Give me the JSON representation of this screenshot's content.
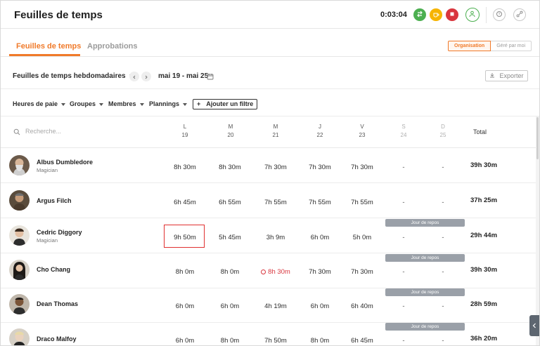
{
  "header": {
    "title": "Feuilles de temps",
    "timer": "0:03:04",
    "colors": {
      "accent": "#f07a2a",
      "green": "#4caf50",
      "yellow": "#f6b400",
      "red": "#d9363e"
    }
  },
  "tabs": [
    {
      "label": "Feuilles de temps",
      "active": true
    },
    {
      "label": "Approbations",
      "active": false
    }
  ],
  "view_toggle": {
    "left": "Organisation",
    "right": "Géré par moi",
    "selected": "Organisation"
  },
  "week": {
    "selector_label": "Feuilles de temps hebdomadaires",
    "range": "mai 19 - mai 25",
    "export_label": "Exporter"
  },
  "filters": {
    "items": [
      "Heures de paie",
      "Groupes",
      "Membres",
      "Plannings"
    ],
    "add_label": "Ajouter un filtre"
  },
  "table": {
    "search_placeholder": "Recherche...",
    "days": [
      {
        "letter": "L",
        "date": "19"
      },
      {
        "letter": "M",
        "date": "20"
      },
      {
        "letter": "M",
        "date": "21"
      },
      {
        "letter": "J",
        "date": "22"
      },
      {
        "letter": "V",
        "date": "23"
      },
      {
        "letter": "S",
        "date": "24"
      },
      {
        "letter": "D",
        "date": "25"
      }
    ],
    "total_label": "Total",
    "repos_label": "Jour de repos",
    "rows": [
      {
        "name": "Albus Dumbledore",
        "role": "Magician",
        "cells": [
          "8h 30m",
          "8h 30m",
          "7h 30m",
          "7h 30m",
          "7h 30m",
          "-",
          "-"
        ],
        "total": "39h 30m"
      },
      {
        "name": "Argus Filch",
        "role": "",
        "cells": [
          "6h 45m",
          "6h 55m",
          "7h 55m",
          "7h 55m",
          "7h 55m",
          "-",
          "-"
        ],
        "total": "37h 25m"
      },
      {
        "name": "Cedric Diggory",
        "role": "Magician",
        "cells": [
          "9h 50m",
          "5h 45m",
          "3h 9m",
          "6h 0m",
          "5h 0m",
          "-",
          "-"
        ],
        "total": "29h 44m"
      },
      {
        "name": "Cho Chang",
        "role": "",
        "cells": [
          "8h 0m",
          "8h 0m",
          "8h 30m",
          "7h 30m",
          "7h 30m",
          "-",
          "-"
        ],
        "total": "39h 30m"
      },
      {
        "name": "Dean Thomas",
        "role": "",
        "cells": [
          "6h 0m",
          "6h 0m",
          "4h 19m",
          "6h 0m",
          "6h 40m",
          "-",
          "-"
        ],
        "total": "28h 59m"
      },
      {
        "name": "Draco Malfoy",
        "role": "",
        "cells": [
          "6h 0m",
          "8h 0m",
          "7h 50m",
          "8h 0m",
          "6h 45m",
          "-",
          "-"
        ],
        "total": "36h 20m"
      }
    ]
  }
}
